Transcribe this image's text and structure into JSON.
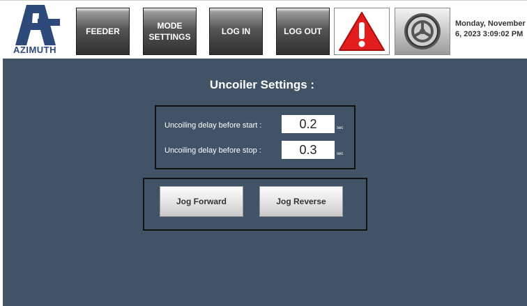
{
  "header": {
    "logo_text": "AZIMUTH",
    "nav": {
      "feeder": "FEEDER",
      "mode_settings": "MODE\nSETTINGS",
      "log_in": "LOG IN",
      "log_out": "LOG OUT"
    },
    "alarm_icon": "alarm-warning-icon",
    "settings_icon": "gear-icon",
    "datetime_line1": "Monday, November",
    "datetime_line2": "6, 2023 3:09:02 PM"
  },
  "main": {
    "title": "Uncoiler Settings :",
    "settings": [
      {
        "label": "Uncoiling delay before start :",
        "value": "0.2",
        "unit": "sec"
      },
      {
        "label": "Uncoiling delay before stop :",
        "value": "0.3",
        "unit": "sec"
      }
    ],
    "jog": {
      "forward_label": "Jog Forward",
      "reverse_label": "Jog Reverse"
    }
  },
  "colors": {
    "background": "#415467",
    "alarm_red": "#e31d1d",
    "logo_blue": "#2d4a7a"
  }
}
